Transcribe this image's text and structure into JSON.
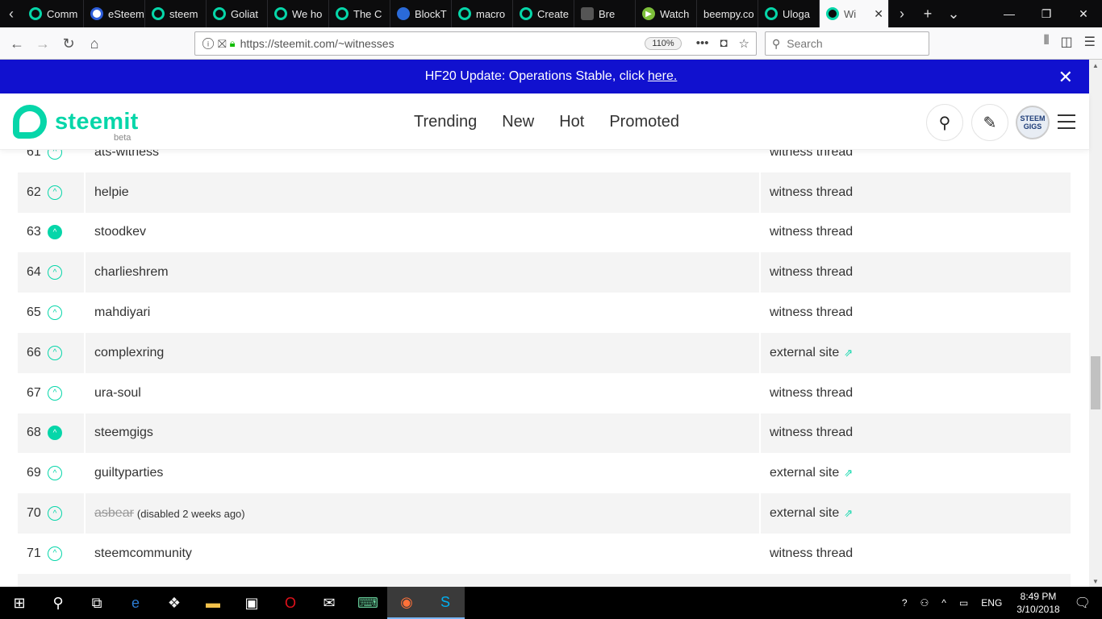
{
  "browser": {
    "tabs": [
      {
        "label": "Comm",
        "favicon": "steem"
      },
      {
        "label": "eSteem",
        "favicon": "esteem"
      },
      {
        "label": "steem",
        "favicon": "steem"
      },
      {
        "label": "Goliat",
        "favicon": "steem"
      },
      {
        "label": "We ho",
        "favicon": "steem"
      },
      {
        "label": "The C",
        "favicon": "steem-lines"
      },
      {
        "label": "BlockT",
        "favicon": "blue"
      },
      {
        "label": "macro",
        "favicon": "steem"
      },
      {
        "label": "Create",
        "favicon": "steem"
      },
      {
        "label": "Bre",
        "favicon": "film"
      },
      {
        "label": "Watch",
        "favicon": "play"
      },
      {
        "label": "beempy.co",
        "favicon": "none"
      },
      {
        "label": "Uloga",
        "favicon": "steem"
      },
      {
        "label": "Wi",
        "favicon": "steem",
        "active": true
      }
    ],
    "url": "https://steemit.com/~witnesses",
    "zoom": "110%",
    "search_placeholder": "Search"
  },
  "announcement": {
    "text": "HF20 Update: Operations Stable, click",
    "link": "here."
  },
  "header": {
    "logo": "steemit",
    "beta": "beta",
    "nav": [
      "Trending",
      "New",
      "Hot",
      "Promoted"
    ],
    "avatar_line1": "STEEM",
    "avatar_line2": "GIGS"
  },
  "witnesses": [
    {
      "rank": "61",
      "name": "ats-witness",
      "link": "witness thread",
      "voted": false,
      "external": false
    },
    {
      "rank": "62",
      "name": "helpie",
      "link": "witness thread",
      "voted": false,
      "external": false
    },
    {
      "rank": "63",
      "name": "stoodkev",
      "link": "witness thread",
      "voted": true,
      "external": false
    },
    {
      "rank": "64",
      "name": "charlieshrem",
      "link": "witness thread",
      "voted": false,
      "external": false
    },
    {
      "rank": "65",
      "name": "mahdiyari",
      "link": "witness thread",
      "voted": false,
      "external": false
    },
    {
      "rank": "66",
      "name": "complexring",
      "link": "external site",
      "voted": false,
      "external": true
    },
    {
      "rank": "67",
      "name": "ura-soul",
      "link": "witness thread",
      "voted": false,
      "external": false
    },
    {
      "rank": "68",
      "name": "steemgigs",
      "link": "witness thread",
      "voted": true,
      "external": false
    },
    {
      "rank": "69",
      "name": "guiltyparties",
      "link": "external site",
      "voted": false,
      "external": true
    },
    {
      "rank": "70",
      "name": "asbear",
      "note": "(disabled 2 weeks ago)",
      "disabled": true,
      "link": "external site",
      "voted": false,
      "external": true
    },
    {
      "rank": "71",
      "name": "steemcommunity",
      "link": "witness thread",
      "voted": false,
      "external": false
    }
  ],
  "taskbar": {
    "language": "ENG",
    "time": "8:49 PM",
    "date": "3/10/2018"
  },
  "colors": {
    "accent": "#06d6a9",
    "announcement_bg": "#1111cf",
    "row_alt": "#f4f4f4"
  }
}
